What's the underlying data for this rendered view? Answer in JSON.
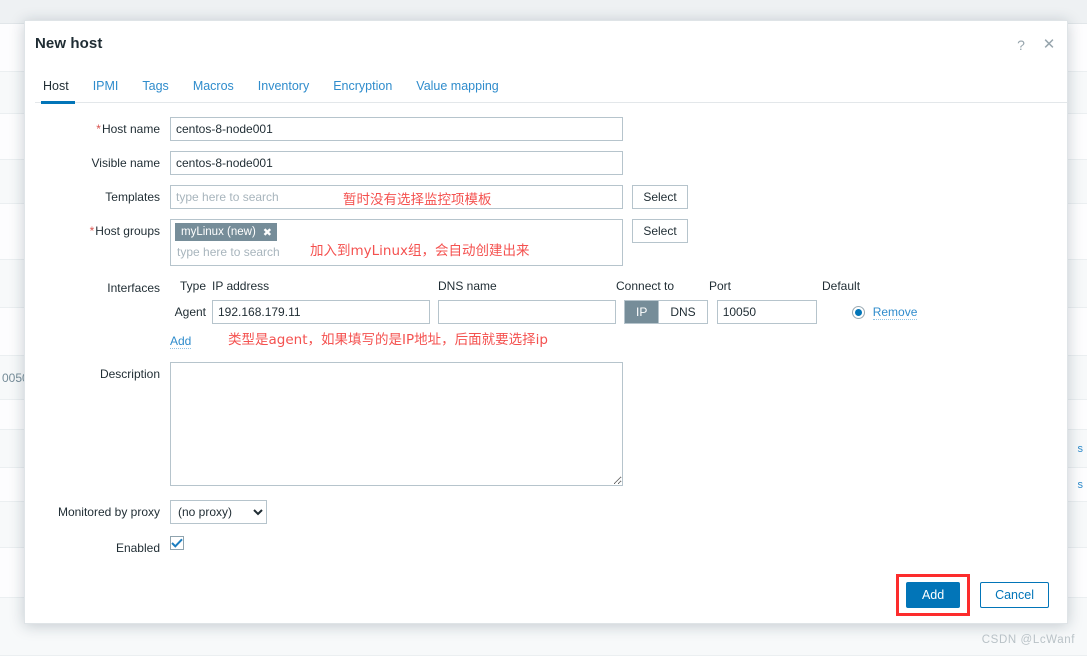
{
  "background": {
    "left_cell_text": "0050",
    "right_cell_texts": [
      "s",
      "s"
    ],
    "rows": 14
  },
  "modal": {
    "title": "New host",
    "help_icon": "question-mark-icon",
    "close_icon": "close-icon",
    "tabs": [
      {
        "label": "Host",
        "active": true
      },
      {
        "label": "IPMI",
        "active": false
      },
      {
        "label": "Tags",
        "active": false
      },
      {
        "label": "Macros",
        "active": false
      },
      {
        "label": "Inventory",
        "active": false
      },
      {
        "label": "Encryption",
        "active": false
      },
      {
        "label": "Value mapping",
        "active": false
      }
    ]
  },
  "form": {
    "host_name": {
      "label": "Host name",
      "required": "*",
      "value": "centos-8-node001"
    },
    "visible_name": {
      "label": "Visible name",
      "value": "centos-8-node001"
    },
    "templates": {
      "label": "Templates",
      "placeholder": "type here to search",
      "value": "",
      "select_label": "Select",
      "note": "暂时没有选择监控项模板"
    },
    "host_groups": {
      "label": "Host groups",
      "required": "*",
      "chip": "myLinux (new)",
      "chip_remove": "✖",
      "placeholder": "type here to search",
      "select_label": "Select",
      "note": "加入到myLinux组，会自动创建出来"
    },
    "interfaces": {
      "label": "Interfaces",
      "columns": {
        "type": "Type",
        "ip_address": "IP address",
        "dns_name": "DNS name",
        "connect_to": "Connect to",
        "port": "Port",
        "default": "Default"
      },
      "row": {
        "type": "Agent",
        "ip_value": "192.168.179.11",
        "dns_value": "",
        "connect_options": [
          "IP",
          "DNS"
        ],
        "connect_selected": "IP",
        "port_value": "10050",
        "default_selected": true,
        "remove_label": "Remove"
      },
      "add_label": "Add",
      "note": "类型是agent，如果填写的是IP地址，后面就要选择ip"
    },
    "description": {
      "label": "Description",
      "value": ""
    },
    "monitored_by_proxy": {
      "label": "Monitored by proxy",
      "selected": "(no proxy)",
      "options": [
        "(no proxy)"
      ]
    },
    "enabled": {
      "label": "Enabled",
      "checked": true
    }
  },
  "footer": {
    "add_label": "Add",
    "cancel_label": "Cancel",
    "highlight_color": "#fc2c2c"
  },
  "watermark": "CSDN @LcWanf",
  "colors": {
    "accent_blue": "#0275b8",
    "link_blue": "#2f8ccc",
    "note_red": "#f4514f",
    "chip_gray": "#768d99"
  }
}
